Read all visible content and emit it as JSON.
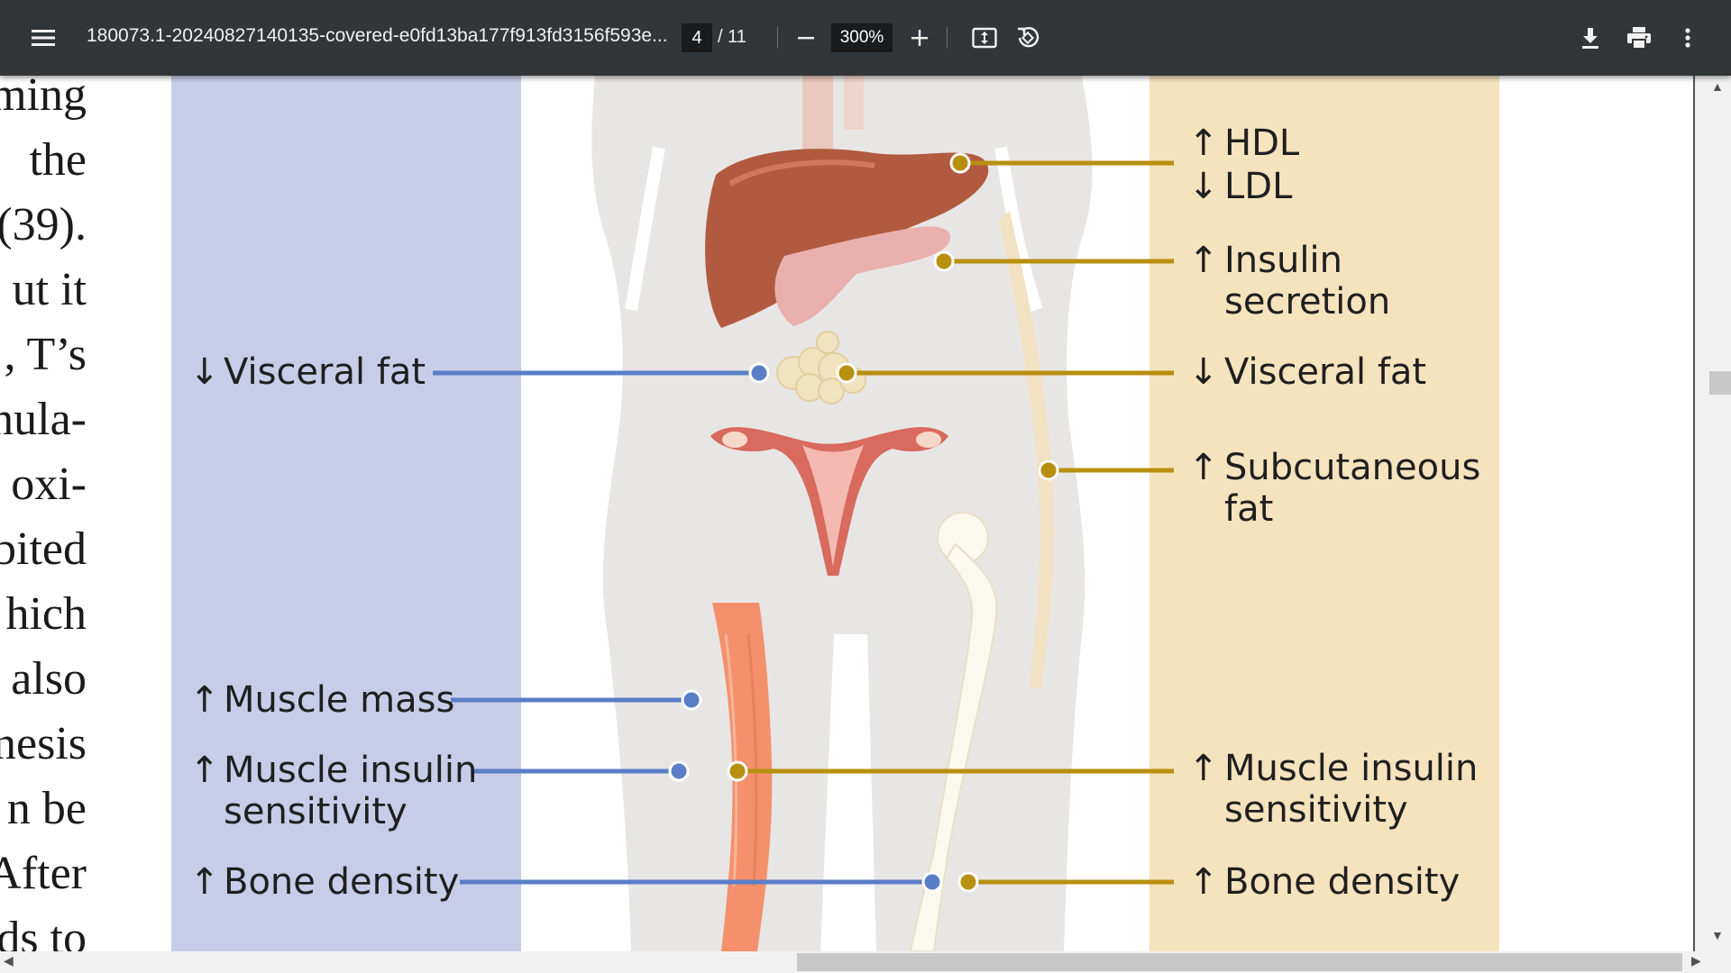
{
  "toolbar": {
    "document_title": "180073.1-20240827140135-covered-e0fd13ba177f913fd3156f593e...",
    "current_page": "4",
    "page_total": "/ 11",
    "zoom": "300%",
    "icons": [
      "menu-icon",
      "zoom-out-icon",
      "zoom-in-icon",
      "fit-page-icon",
      "rotate-icon",
      "download-icon",
      "print-icon",
      "more-vert-icon"
    ]
  },
  "body_text_fragments": [
    "ming",
    "the",
    "(39).",
    "ut it",
    ", T’s",
    "nula-",
    "oxi-",
    "bited",
    "hich",
    "also",
    "nesis",
    "n be",
    "After",
    "ds to"
  ],
  "figure": {
    "colors": {
      "left_panel": "#c7cde9",
      "right_panel": "#f5e3bd",
      "blue_line": "#5a7ec8",
      "gold_line": "#b8900f",
      "silhouette": "#e8e6e4"
    },
    "left_labels": [
      {
        "arrow": "↓",
        "text": "Visceral fat"
      },
      {
        "arrow": "↑",
        "text": "Muscle mass"
      },
      {
        "arrow": "↑",
        "text": "Muscle insulin",
        "line2": "sensitivity"
      },
      {
        "arrow": "↑",
        "text": "Bone density"
      }
    ],
    "right_labels": [
      {
        "arrow": "↑",
        "text": "HDL"
      },
      {
        "arrow": "↓",
        "text": "LDL"
      },
      {
        "arrow": "↑",
        "text": "Insulin",
        "line2": "secretion"
      },
      {
        "arrow": "↓",
        "text": "Visceral fat"
      },
      {
        "arrow": "↑",
        "text": "Subcutaneous",
        "line2": "fat"
      },
      {
        "arrow": "↑",
        "text": "Muscle insulin",
        "line2": "sensitivity"
      },
      {
        "arrow": "↑",
        "text": "Bone density"
      }
    ]
  }
}
